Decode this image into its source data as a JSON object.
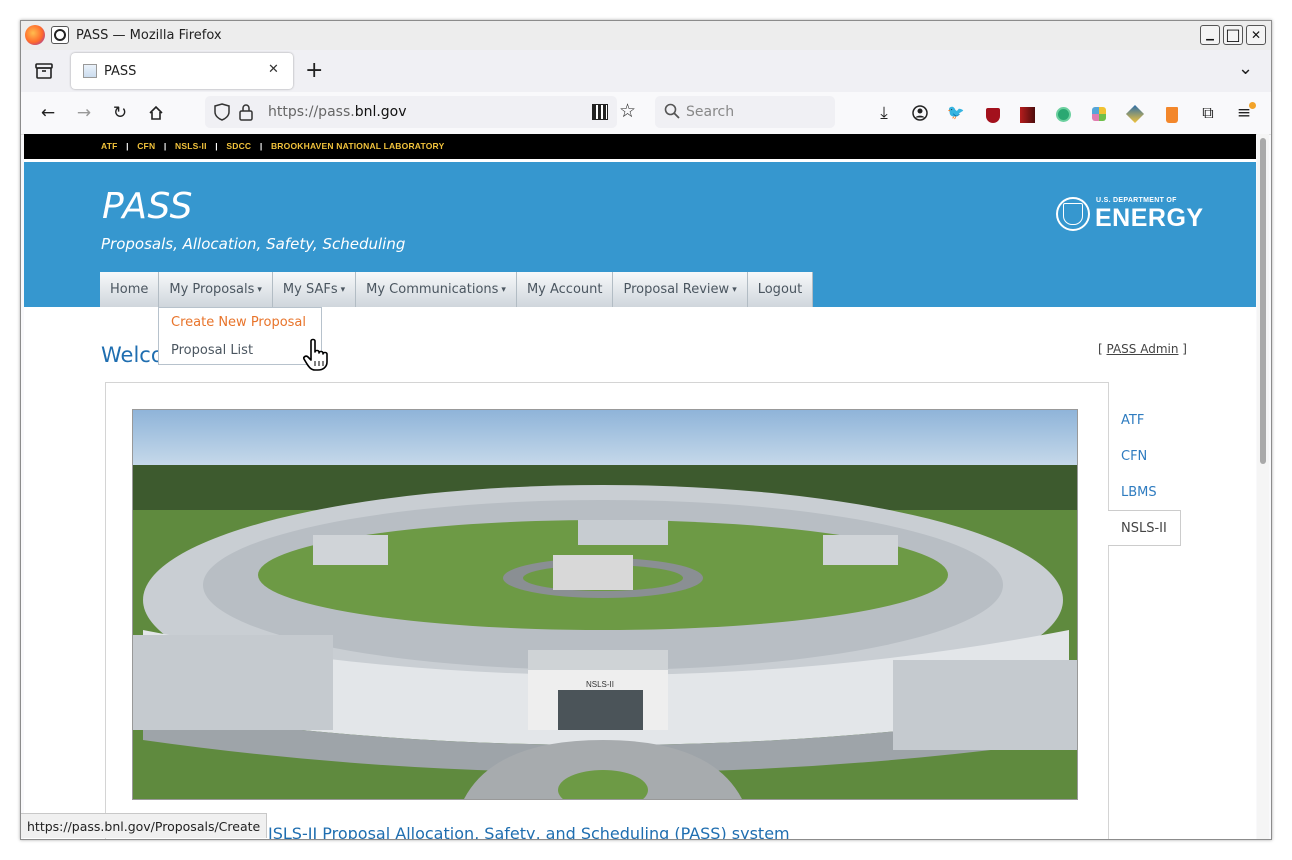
{
  "window": {
    "title": "PASS — Mozilla Firefox",
    "minimize_glyph": "▁",
    "maximize_glyph": "□",
    "close_glyph": "✕"
  },
  "tabs": [
    {
      "label": "PASS",
      "close_glyph": "✕"
    }
  ],
  "new_tab_glyph": "+",
  "tab_list_glyph": "⌄",
  "navbar": {
    "url_prefix": "https://pass.",
    "url_domain": "bnl.gov",
    "search_placeholder": "Search"
  },
  "site": {
    "top_links": [
      "ATF",
      "CFN",
      "NSLS-II",
      "SDCC",
      "BROOKHAVEN NATIONAL LABORATORY"
    ],
    "top_separator": "|",
    "title": "PASS",
    "subtitle": "Proposals, Allocation, Safety, Scheduling",
    "doe_small": "U.S. DEPARTMENT OF",
    "doe_big": "ENERGY",
    "menu": [
      {
        "label": "Home",
        "has_caret": false
      },
      {
        "label": "My Proposals",
        "has_caret": true
      },
      {
        "label": "My SAFs",
        "has_caret": true
      },
      {
        "label": "My Communications",
        "has_caret": true
      },
      {
        "label": "My Account",
        "has_caret": false
      },
      {
        "label": "Proposal Review",
        "has_caret": true
      },
      {
        "label": "Logout",
        "has_caret": false
      }
    ],
    "caret_glyph": "▾",
    "dropdown": [
      "Create New Proposal",
      "Proposal List"
    ],
    "welcome": "Welco",
    "admin_open": "[ ",
    "admin_link": "PASS Admin",
    "admin_close": " ]",
    "side_tabs": [
      "ATF",
      "CFN",
      "LBMS",
      "NSLS-II"
    ],
    "active_side_tab": "NSLS-II",
    "photo_sign": "NSLS-II",
    "bottom_heading": "ISLS-II Proposal Allocation, Safety, and Scheduling (PASS) system"
  },
  "status_url": "https://pass.bnl.gov/Proposals/Create",
  "colors": {
    "header_blue": "#3697cf",
    "menu_text": "#4b5660",
    "link_blue": "#2f7cc0",
    "dropdown_active": "#e8742b",
    "top_links_gold": "#f2c33c"
  }
}
